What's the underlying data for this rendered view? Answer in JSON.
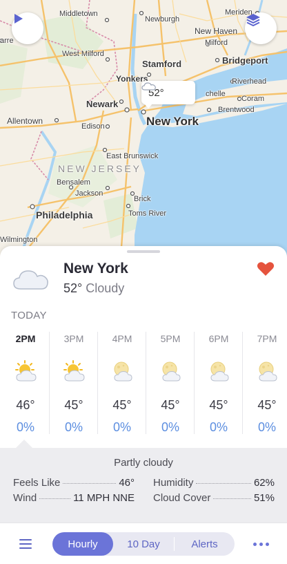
{
  "map": {
    "labels": {
      "middletown": "Middletown",
      "newburgh": "Newburgh",
      "meriden": "Meriden",
      "new_haven": "New Haven",
      "milford": "Milford",
      "west_milford": "West Milford",
      "stamford": "Stamford",
      "bridgeport": "Bridgeport",
      "yonkers": "Yonkers",
      "riverhead": "Riverhead",
      "newark": "Newark",
      "new_york": "New York",
      "coram": "Coram",
      "brentwood": "Brentwood",
      "allentown": "Allentown",
      "edison": "Edison",
      "east_brunswick": "East Brunswick",
      "new_jersey": "NEW JERSEY",
      "bensalem": "Bensalem",
      "jackson": "Jackson",
      "brick": "Brick",
      "philadelphia": "Philadelphia",
      "toms_river": "Toms River",
      "wilmington": "Wilmington",
      "arre": "arre",
      "chelle": "chelle"
    },
    "temp_bubble": "52°",
    "play_icon": "play-icon",
    "layers_icon": "layers-icon"
  },
  "location": {
    "city": "New York",
    "temp": "52°",
    "condition": "Cloudy",
    "favorite_icon": "heart-icon",
    "favorite_color": "#e5533d"
  },
  "today_label": "TODAY",
  "hourly": [
    {
      "time": "2PM",
      "icon": "partly-sunny-icon",
      "temp": "46°",
      "precip": "0%",
      "current": true
    },
    {
      "time": "3PM",
      "icon": "partly-sunny-icon",
      "temp": "45°",
      "precip": "0%",
      "current": false
    },
    {
      "time": "4PM",
      "icon": "partly-cloudy-moon-icon",
      "temp": "45°",
      "precip": "0%",
      "current": false
    },
    {
      "time": "5PM",
      "icon": "partly-cloudy-moon-icon",
      "temp": "45°",
      "precip": "0%",
      "current": false
    },
    {
      "time": "6PM",
      "icon": "partly-cloudy-moon-icon",
      "temp": "45°",
      "precip": "0%",
      "current": false
    },
    {
      "time": "7PM",
      "icon": "partly-cloudy-moon-icon",
      "temp": "45°",
      "precip": "0%",
      "current": false
    }
  ],
  "detail": {
    "summary": "Partly cloudy",
    "feels_like": {
      "label": "Feels Like",
      "value": "46°"
    },
    "humidity": {
      "label": "Humidity",
      "value": "62%"
    },
    "wind": {
      "label": "Wind",
      "value": "11 MPH NNE"
    },
    "cloud_cover": {
      "label": "Cloud Cover",
      "value": "51%"
    }
  },
  "bottom_bar": {
    "tabs": [
      "Hourly",
      "10 Day",
      "Alerts"
    ],
    "active_tab": "Hourly",
    "accent": "#6b74d8"
  }
}
